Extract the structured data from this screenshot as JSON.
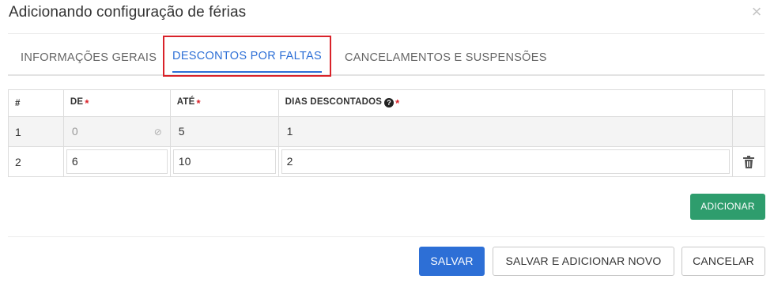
{
  "dialog": {
    "title": "Adicionando configuração de férias",
    "close_icon": "×"
  },
  "tabs": [
    {
      "label": "INFORMAÇÕES GERAIS",
      "active": false
    },
    {
      "label": "DESCONTOS POR FALTAS",
      "active": true
    },
    {
      "label": "CANCELAMENTOS E SUSPENSÕES",
      "active": false
    }
  ],
  "table": {
    "headers": {
      "index": "#",
      "from": "DE",
      "to": "ATÉ",
      "days": "DIAS DESCONTADOS"
    },
    "required_mark": "*",
    "help_icon": "?",
    "rows": [
      {
        "index": "1",
        "from": "0",
        "to": "5",
        "days": "1",
        "from_disabled": true,
        "deletable": false
      },
      {
        "index": "2",
        "from": "6",
        "to": "10",
        "days": "2",
        "from_disabled": false,
        "deletable": true
      }
    ]
  },
  "buttons": {
    "add": "ADICIONAR",
    "save": "SALVAR",
    "save_and_new": "SALVAR E ADICIONAR NOVO",
    "cancel": "CANCELAR"
  },
  "colors": {
    "primary": "#2d6fd6",
    "success": "#2e9d6d",
    "required": "#d9222a",
    "highlight_box": "#d9222a"
  }
}
